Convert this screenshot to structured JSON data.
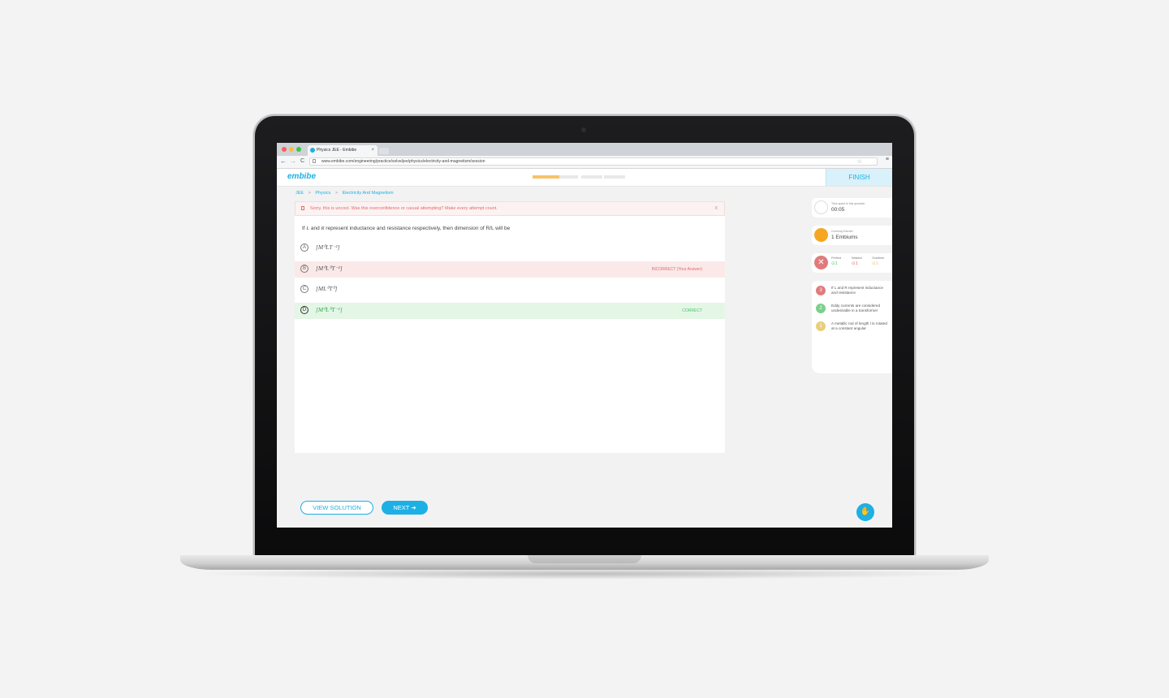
{
  "browser": {
    "tab_title": "Physics JEE - Embibe",
    "tab_close": "×",
    "url": "www.embibe.com/engineering/practice/solve/jee/physics/electricity-and-magnetism/session",
    "back": "←",
    "forward": "→",
    "reload": "C",
    "star": "☆",
    "menu": "≡",
    "window_colors": [
      "#fc605c",
      "#fdbc40",
      "#34c84a"
    ]
  },
  "header": {
    "logo": "embibe",
    "finish_label": "FINISH",
    "progress_segments": 4,
    "progress_value": 0.29
  },
  "breadcrumb": {
    "items": [
      "JEE",
      "Physics",
      "Electricity And Magnetism"
    ],
    "separator": ">"
  },
  "alert": {
    "text": "Sorry, this is uncool. Was this overconfidence or casual attempting? Make every attempt count.",
    "close": "x"
  },
  "question": {
    "prefix": "If ",
    "var1": "L",
    "mid1": " and ",
    "var2": "R",
    "suffix": " represent inductance and resistance respectively, then dimension of R/L will be"
  },
  "options": [
    {
      "letter": "A",
      "math": "[M⁰LT⁻²]",
      "status": "",
      "state": "normal"
    },
    {
      "letter": "B",
      "math": "[M⁰L⁰T⁻²]",
      "status": "INCORRECT (Your Answer)",
      "state": "wrong"
    },
    {
      "letter": "C",
      "math": "[ML⁰T⁰]",
      "status": "",
      "state": "normal"
    },
    {
      "letter": "D",
      "math": "[M⁰L⁰T⁻¹]",
      "status": "CORRECT",
      "state": "right"
    }
  ],
  "actions": {
    "view_solution": "VIEW SOLUTION",
    "next": "NEXT ➔"
  },
  "sidebar": {
    "time": {
      "title": "Time spent in this question",
      "value": "00:05"
    },
    "currency": {
      "title": "Currency Earned",
      "value": "1 Embiums"
    },
    "stats": {
      "perfect_label": "Perfect",
      "perfect_value": "⊙1",
      "wasted_label": "Wasted",
      "wasted_value": "⊙1",
      "overtime_label": "Overtime",
      "overtime_value": "⊙1"
    },
    "history": [
      {
        "num": "3",
        "text": "If L and R represent inductance and resistance",
        "color": "#e07b7b"
      },
      {
        "num": "2",
        "text": "Eddy currents are considered undesirable in a transformer",
        "color": "#7ccf8c"
      },
      {
        "num": "1",
        "text": "A metallic rod of length l is rotated at a constant angular",
        "color": "#e8cf7c"
      }
    ]
  },
  "colors": {
    "accent": "#1cb0e4",
    "incorrect": "#e06b6b",
    "correct": "#48c66a",
    "progress": "#f6c36b"
  }
}
